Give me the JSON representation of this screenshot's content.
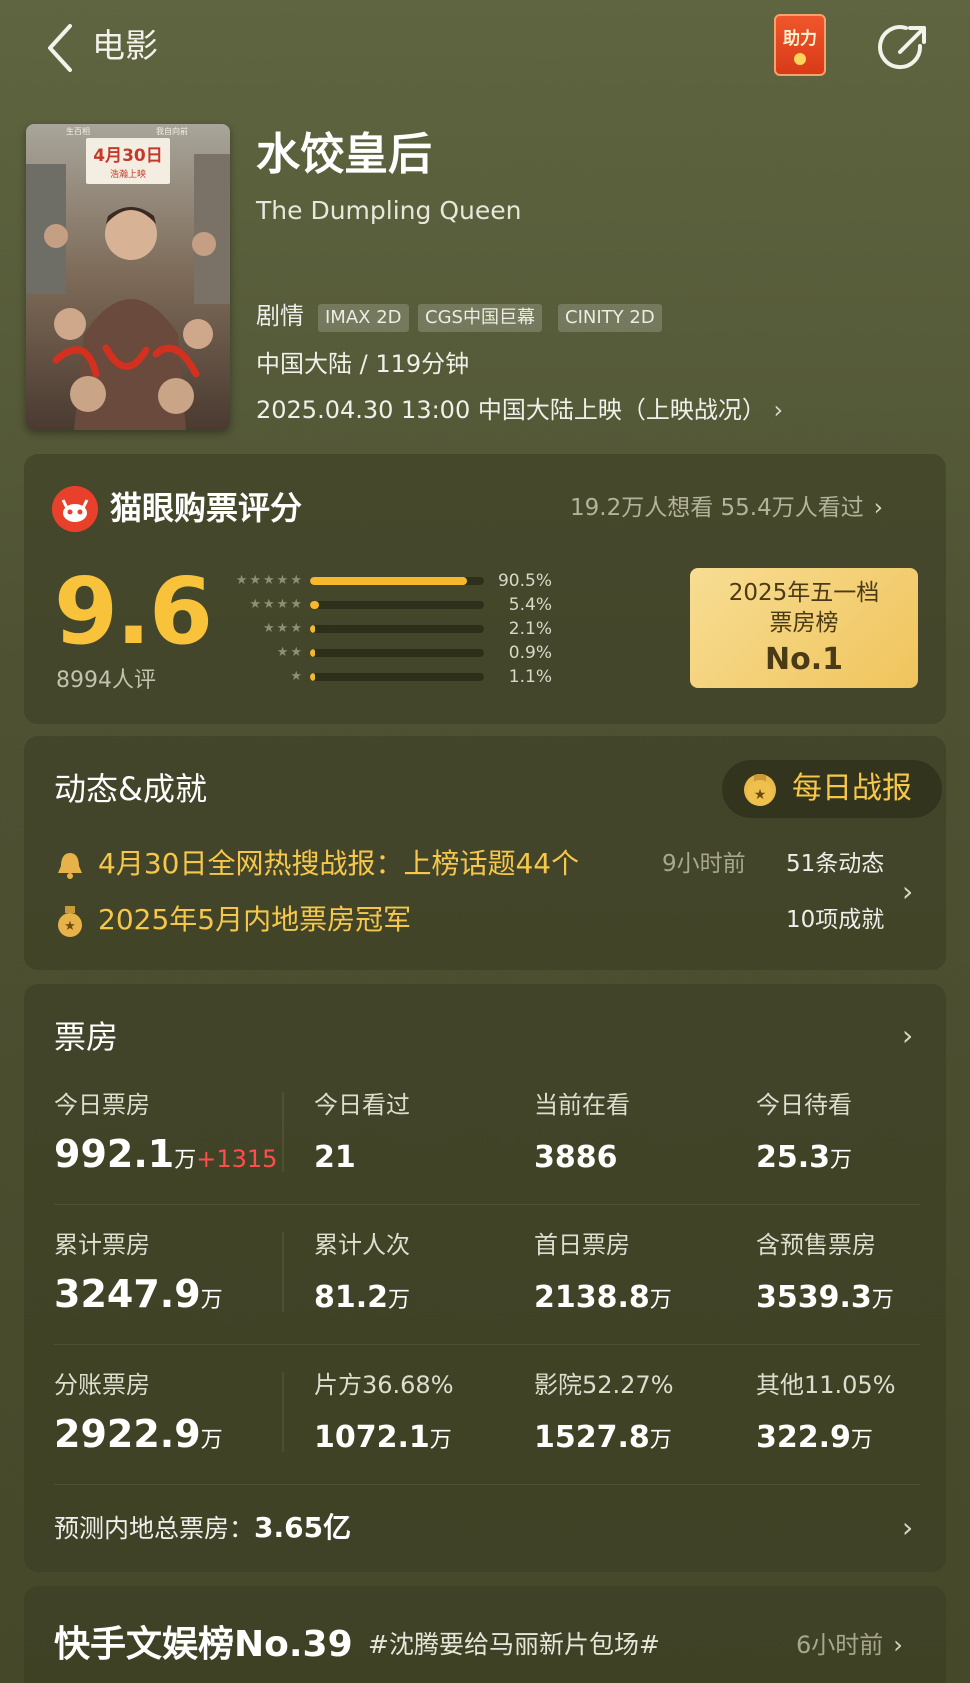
{
  "header": {
    "title": "电影",
    "boost_label": "助力"
  },
  "movie": {
    "title": "水饺皇后",
    "english_title": "The Dumpling Queen",
    "genre": "剧情",
    "tags": [
      "IMAX 2D",
      "CGS中国巨幕",
      "CINITY 2D"
    ],
    "region_duration": "中国大陆 / 119分钟",
    "release": "2025.04.30 13:00 中国大陆上映（上映战况）",
    "poster": {
      "date_text": "4月30日",
      "date_sub": "浩瀚上映",
      "top_left": "生百相",
      "top_right": "我自向前"
    }
  },
  "rating": {
    "title": "猫眼购票评分",
    "meta": "19.2万人想看 55.4万人看过",
    "score": "9.6",
    "count": "8994人评",
    "distribution": [
      {
        "stars": 5,
        "percent": 90.5,
        "label": "90.5%"
      },
      {
        "stars": 4,
        "percent": 5.4,
        "label": "5.4%"
      },
      {
        "stars": 3,
        "percent": 2.1,
        "label": "2.1%"
      },
      {
        "stars": 2,
        "percent": 0.9,
        "label": "0.9%"
      },
      {
        "stars": 1,
        "percent": 1.1,
        "label": "1.1%"
      }
    ],
    "rank": {
      "line1": "2025年五一档",
      "line2": "票房榜",
      "line3": "No.1"
    }
  },
  "news": {
    "title": "动态&成就",
    "daily_label": "每日战报",
    "line1": "4月30日全网热搜战报：上榜话题44个",
    "line1_time": "9小时前",
    "line1_right": "51条动态",
    "line2": "2025年5月内地票房冠军",
    "line2_right": "10项成就"
  },
  "boxoffice": {
    "title": "票房",
    "cells": [
      {
        "label": "今日票房",
        "value": "992.1",
        "unit": "万",
        "inc": "+1315"
      },
      {
        "label": "今日看过",
        "value": "21",
        "unit": ""
      },
      {
        "label": "当前在看",
        "value": "3886",
        "unit": ""
      },
      {
        "label": "今日待看",
        "value": "25.3",
        "unit": "万"
      },
      {
        "label": "累计票房",
        "value": "3247.9",
        "unit": "万"
      },
      {
        "label": "累计人次",
        "value": "81.2",
        "unit": "万"
      },
      {
        "label": "首日票房",
        "value": "2138.8",
        "unit": "万"
      },
      {
        "label": "含预售票房",
        "value": "3539.3",
        "unit": "万"
      },
      {
        "label": "分账票房",
        "value": "2922.9",
        "unit": "万"
      },
      {
        "label": "片方36.68%",
        "value": "1072.1",
        "unit": "万"
      },
      {
        "label": "影院52.27%",
        "value": "1527.8",
        "unit": "万"
      },
      {
        "label": "其他11.05%",
        "value": "322.9",
        "unit": "万"
      }
    ],
    "predict_label": "预测内地总票房：",
    "predict_value": "3.65亿"
  },
  "kuaishou": {
    "title": "快手文娱榜No.39",
    "tag": "#沈腾要给马丽新片包场#",
    "time": "6小时前"
  },
  "colors": {
    "accent": "#f8c33a",
    "bg": "#565a38",
    "increase": "#ff4d4d"
  }
}
